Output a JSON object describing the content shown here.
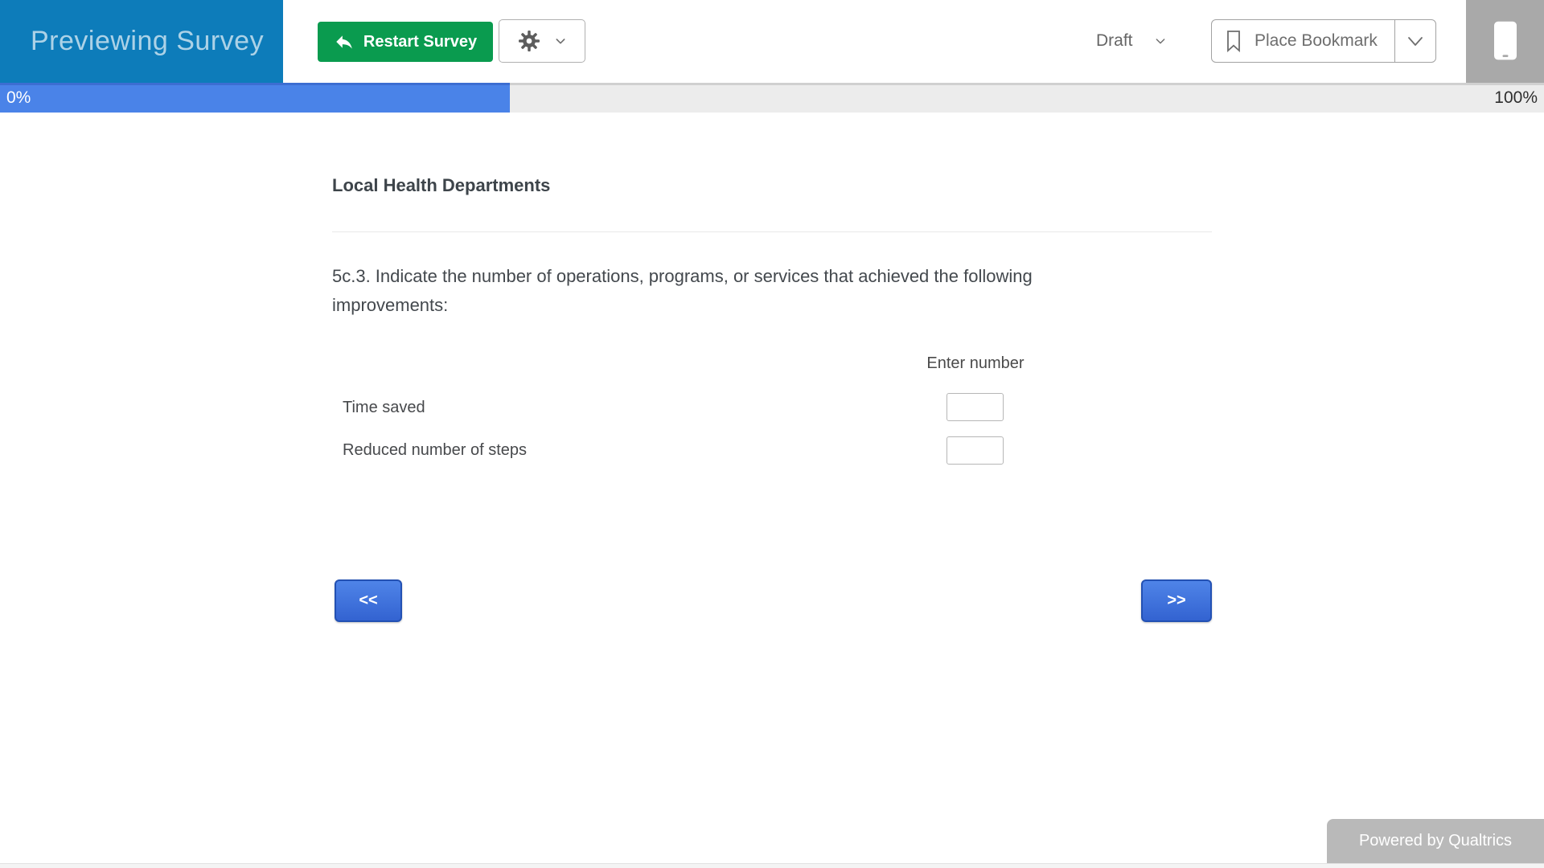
{
  "header": {
    "preview_label": "Previewing Survey",
    "restart_label": "Restart Survey",
    "draft_label": "Draft",
    "bookmark_label": "Place Bookmark"
  },
  "progress": {
    "current_label": "0%",
    "max_label": "100%",
    "fill_percent": 33
  },
  "survey": {
    "block_title": "Local Health Departments",
    "question_text": "5c.3. Indicate the number of operations, programs, or services that achieved the following improvements:",
    "answer_column_header": "Enter number",
    "rows": [
      {
        "label": "Time saved",
        "value": ""
      },
      {
        "label": "Reduced number of steps",
        "value": ""
      }
    ],
    "back_label": "<<",
    "next_label": ">>"
  },
  "footer": {
    "powered_by_label": "Powered by Qualtrics"
  },
  "icons": {
    "restart_icon": "curved-undo-arrow",
    "settings_gear_icon": "gear",
    "chevron_down_icon": "chevron-down",
    "bookmark_icon": "bookmark-outline",
    "mobile_phone_icon": "smartphone"
  },
  "colors": {
    "header_blue": "#0d7cba",
    "restart_green": "#0a9b4f",
    "progress_fill_blue": "#4a83e8",
    "progress_track_gray": "#ececec",
    "nav_button_blue": "#3a6fd8",
    "nav_button_border": "#2351b3",
    "device_panel_gray": "#a9a9a9",
    "badge_gray": "#b9b9b9"
  }
}
